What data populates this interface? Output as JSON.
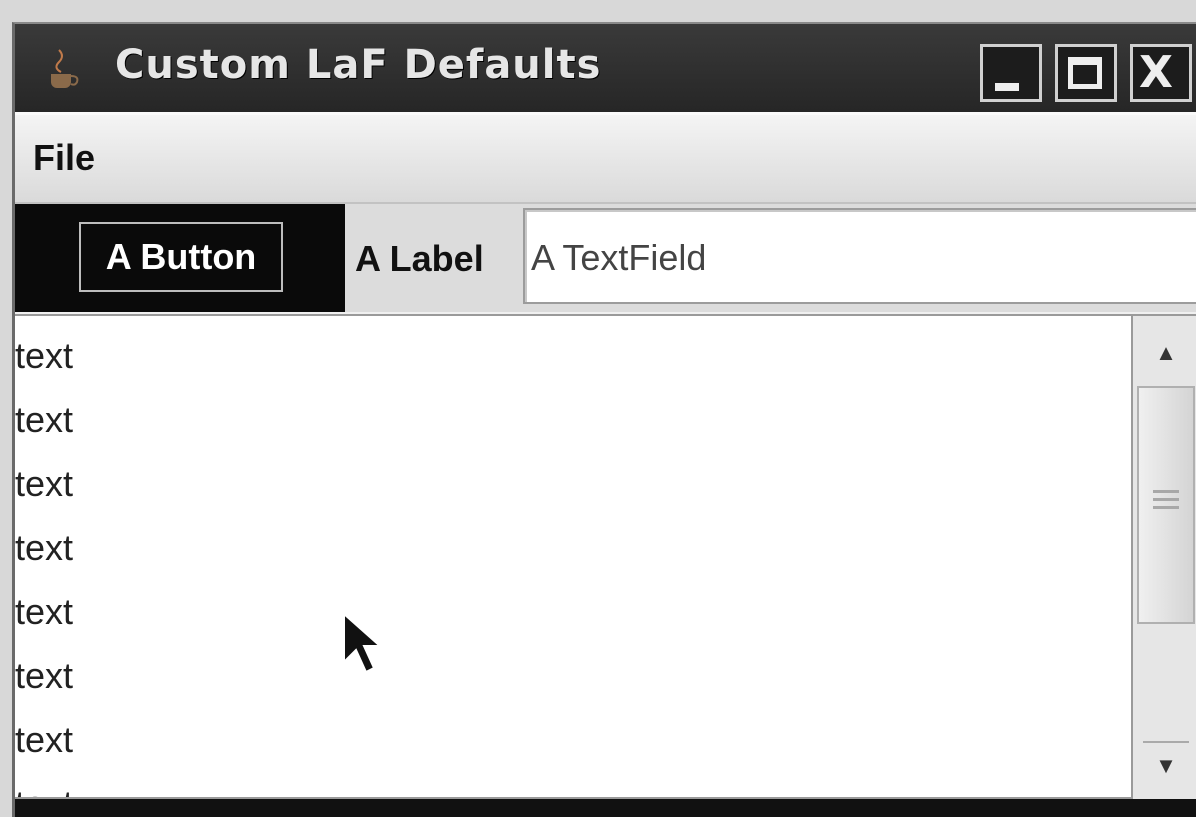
{
  "window": {
    "title": "Custom LaF Defaults",
    "controls": {
      "minimize": "_",
      "maximize": "□",
      "close": "X"
    }
  },
  "menubar": {
    "file_label": "File"
  },
  "toolbar": {
    "button_label": "A Button",
    "label_text": "A Label",
    "textfield_value": "A TextField"
  },
  "list": {
    "items": [
      "text",
      "text",
      "text",
      "text",
      "text",
      "text",
      "text",
      "text"
    ]
  },
  "icons": {
    "app": "java-cup-icon",
    "scroll_up": "▲",
    "scroll_down": "▼"
  }
}
